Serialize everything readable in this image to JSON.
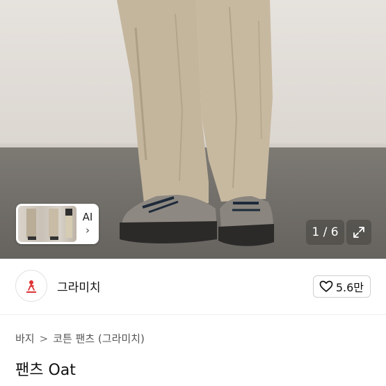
{
  "gallery": {
    "thumbnail_badge": "AI",
    "thumbnail_chevron": "›",
    "image_counter": "1 / 6",
    "expand_icon": "expand-arrows-icon"
  },
  "seller": {
    "name": "그라미치",
    "avatar_icon": "gramicci-logo-icon",
    "like_count": "5.6만",
    "like_icon": "heart-outline-icon"
  },
  "breadcrumb": {
    "level1": "바지",
    "separator": ">",
    "level2": "코튼 팬츠 (그라미치)"
  },
  "product": {
    "title": "팬츠 Oat"
  },
  "colors": {
    "pants": "#c3b59c",
    "floor": "#74716b",
    "wall": "#e0dcd6"
  }
}
